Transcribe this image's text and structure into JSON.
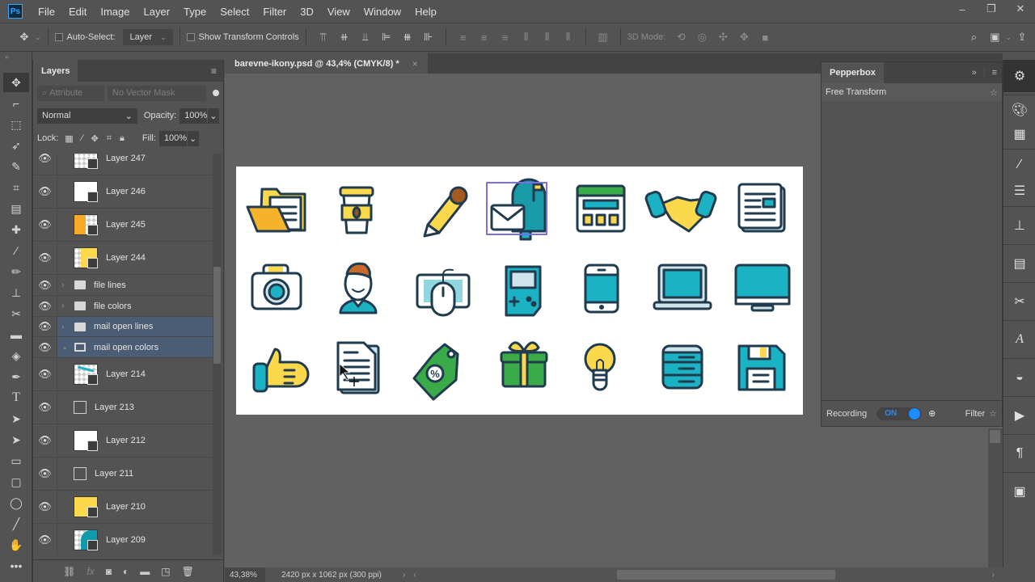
{
  "app": {
    "name": "Adobe Photoshop",
    "logo": "Ps"
  },
  "menu": [
    "File",
    "Edit",
    "Image",
    "Layer",
    "Type",
    "Select",
    "Filter",
    "3D",
    "View",
    "Window",
    "Help"
  ],
  "window_controls": {
    "minimize": "–",
    "restore": "❐",
    "close": "✕"
  },
  "options_bar": {
    "auto_select_label": "Auto-Select:",
    "auto_select_checked": false,
    "auto_select_target": "Layer",
    "show_transform_label": "Show Transform Controls",
    "show_transform_checked": false,
    "mode_3d_label": "3D Mode:"
  },
  "document": {
    "tab_title": "barevne-ikony.psd @ 43,4% (CMYK/8) *",
    "close": "×",
    "canvas_icons": [
      [
        "open-folder",
        "coffee-cup",
        "pencil",
        "mailbox",
        "web-layout",
        "handshake",
        "newspaper"
      ],
      [
        "camera",
        "user-avatar",
        "computer-mouse",
        "game-console",
        "smartphone",
        "laptop",
        "monitor"
      ],
      [
        "thumbs-up",
        "document",
        "discount-tag",
        "gift-box",
        "light-bulb",
        "server",
        "floppy-disk"
      ]
    ],
    "selected_icon": "mailbox",
    "colors": {
      "teal": "#1bb3c4",
      "yellow": "#fcd94c",
      "orange": "#f7b22b",
      "green": "#3bab4a",
      "outline": "#1f3b4d",
      "selection": "#7b6fe8"
    }
  },
  "status_bar": {
    "zoom": "43,38%",
    "doc_info": "2420 px x 1062 px (300 ppi)"
  },
  "layers_panel": {
    "tab": "Layers",
    "filter_placeholder": "Attribute",
    "filter_mask": "No Vector Mask",
    "blend_mode": "Normal",
    "opacity_label": "Opacity:",
    "opacity": "100%",
    "lock_label": "Lock:",
    "fill_label": "Fill:",
    "fill": "100%",
    "layers": [
      {
        "type": "layer",
        "name": "Layer 247",
        "visible": true,
        "thumb": "yellow-corner"
      },
      {
        "type": "layer",
        "name": "Layer 246",
        "visible": true,
        "thumb": "white"
      },
      {
        "type": "layer",
        "name": "Layer 245",
        "visible": true,
        "thumb": "orange"
      },
      {
        "type": "layer",
        "name": "Layer 244",
        "visible": true,
        "thumb": "yellow"
      },
      {
        "type": "group",
        "name": "file lines",
        "visible": true,
        "expanded": false
      },
      {
        "type": "group",
        "name": "file colors",
        "visible": true,
        "expanded": false
      },
      {
        "type": "group",
        "name": "mail open lines",
        "visible": true,
        "expanded": false,
        "selected": true
      },
      {
        "type": "group",
        "name": "mail open colors",
        "visible": true,
        "expanded": true,
        "selected": true
      },
      {
        "type": "layer",
        "name": "Layer 214",
        "visible": true,
        "thumb": "teal-stroke"
      },
      {
        "type": "frame",
        "name": "Layer 213",
        "visible": true
      },
      {
        "type": "layer",
        "name": "Layer 212",
        "visible": true,
        "thumb": "white"
      },
      {
        "type": "frame",
        "name": "Layer 211",
        "visible": true
      },
      {
        "type": "layer",
        "name": "Layer 210",
        "visible": true,
        "thumb": "yellow"
      },
      {
        "type": "layer",
        "name": "Layer 209",
        "visible": true,
        "thumb": "teal"
      }
    ]
  },
  "pepperbox_panel": {
    "tab": "Pepperbox",
    "item": "Free Transform",
    "recording_label": "Recording",
    "recording_state": "ON",
    "filter_label": "Filter"
  }
}
